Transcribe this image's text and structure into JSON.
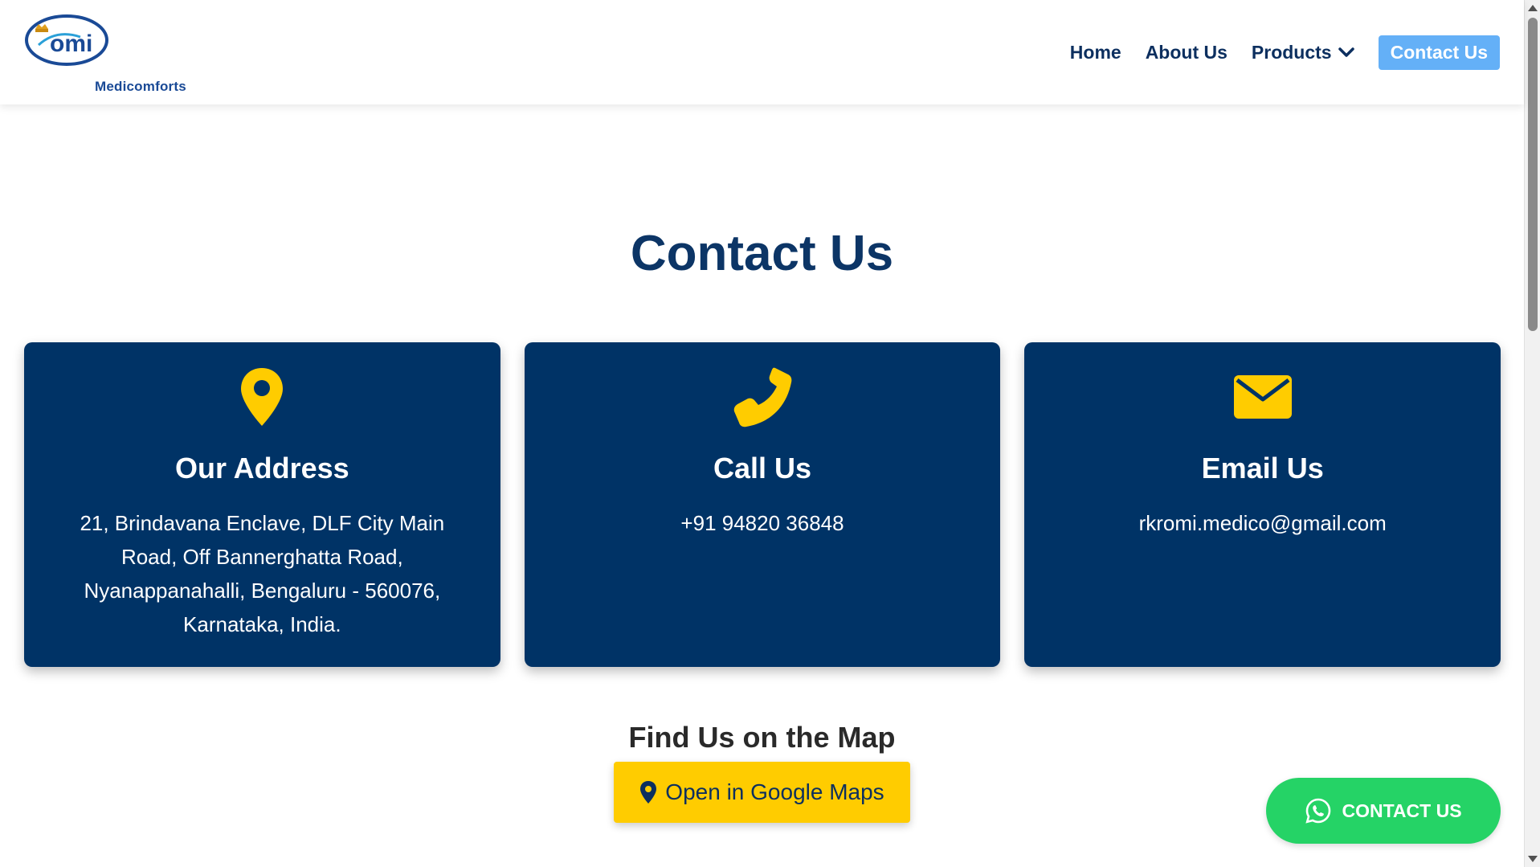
{
  "header": {
    "logo_text": "Medicomforts",
    "nav": [
      {
        "label": "Home"
      },
      {
        "label": "About Us"
      },
      {
        "label": "Products"
      },
      {
        "label": "Contact Us"
      }
    ]
  },
  "main": {
    "title": "Contact Us",
    "cards": [
      {
        "icon": "map-marker-icon",
        "title": "Our Address",
        "text": "21, Brindavana Enclave, DLF City Main Road, Off Bannerghatta Road, Nyanappanahalli, Bengaluru - 560076, Karnataka, India."
      },
      {
        "icon": "phone-icon",
        "title": "Call Us",
        "text": "+91 94820 36848"
      },
      {
        "icon": "envelope-icon",
        "title": "Email Us",
        "text": "rkromi.medico@gmail.com"
      }
    ],
    "map": {
      "title": "Find Us on the Map",
      "button_label": "Open in Google Maps"
    }
  },
  "floating": {
    "whatsapp_label": "CONTACT US"
  },
  "colors": {
    "primary": "#003366",
    "accent": "#ffcc00",
    "nav_contact": "#64b0f7",
    "whatsapp": "#25d366"
  }
}
